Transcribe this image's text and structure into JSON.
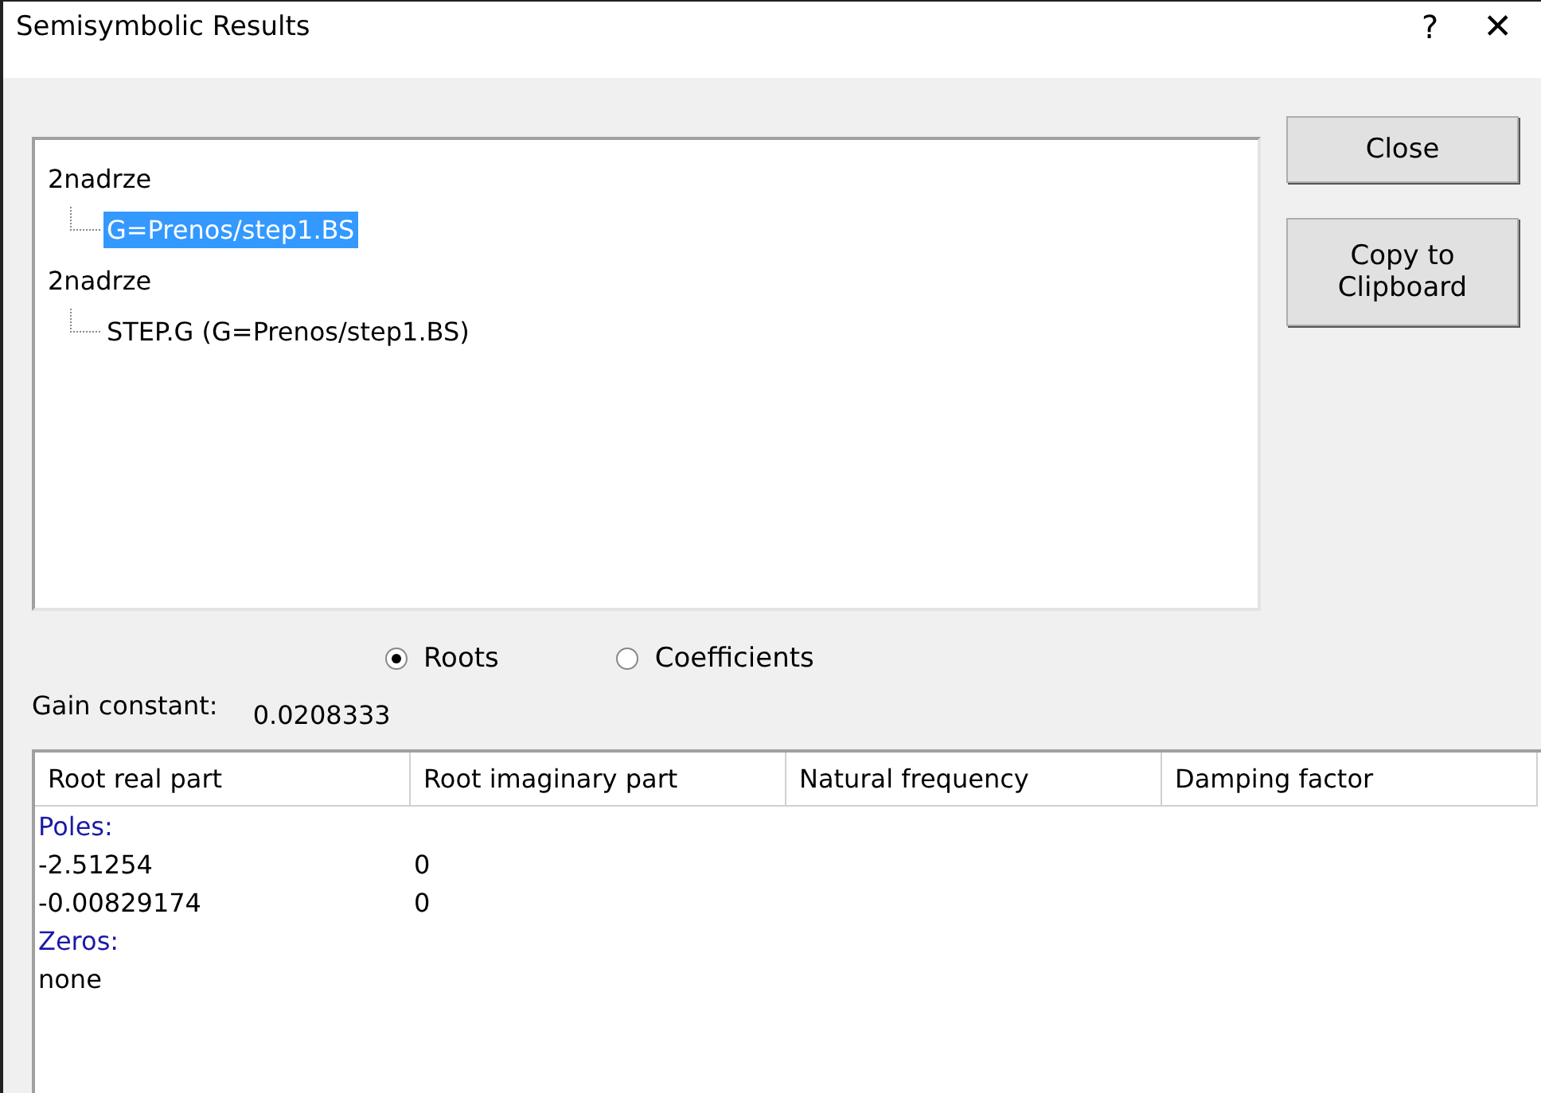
{
  "window": {
    "title": "Semisymbolic Results",
    "help": "?",
    "close": "✕"
  },
  "tree": [
    {
      "label": "2nadrze",
      "selected": false,
      "children": [
        {
          "label": "G=Prenos/step1.BS",
          "selected": true
        }
      ]
    },
    {
      "label": "2nadrze",
      "selected": false,
      "children": [
        {
          "label": "STEP.G (G=Prenos/step1.BS)",
          "selected": false
        }
      ]
    }
  ],
  "buttons": [
    "Close",
    "Copy to Clipboard"
  ],
  "radios": [
    {
      "label": "Roots",
      "selected": true
    },
    {
      "label": "Coefficients",
      "selected": false
    }
  ],
  "gain": {
    "label": "Gain constant:",
    "value": "0.0208333"
  },
  "table": {
    "columns": [
      "Root real part",
      "Root imaginary part",
      "Natural frequency",
      "Damping factor"
    ],
    "rows": [
      {
        "kind": "group",
        "cells": [
          "Poles:"
        ]
      },
      {
        "kind": "value",
        "cells": [
          "-2.51254",
          "0"
        ]
      },
      {
        "kind": "value",
        "cells": [
          "-0.00829174",
          "0"
        ]
      },
      {
        "kind": "group",
        "cells": [
          "Zeros:"
        ]
      },
      {
        "kind": "value",
        "cells": [
          "none"
        ]
      }
    ]
  }
}
